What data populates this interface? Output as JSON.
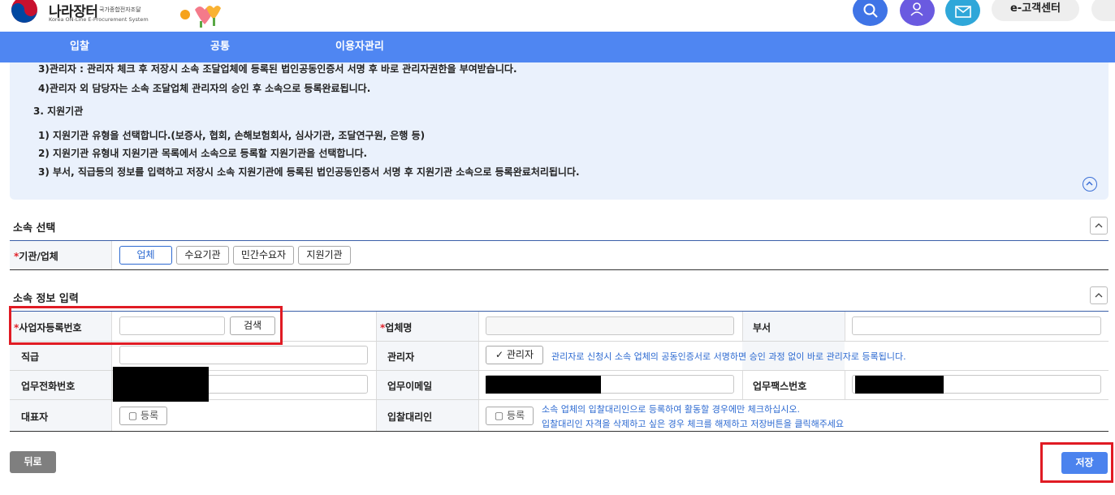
{
  "header": {
    "logo_text": "나라장터",
    "logo_sub": "국가종합전자조달",
    "logo_eng": "Korea ON-Line E-Procurement System",
    "customer_center": "e-고객센터",
    "my_label": "MY"
  },
  "nav": {
    "items": [
      "입찰",
      "공통",
      "이용자관리"
    ]
  },
  "info": {
    "lines": [
      "3)관리자 : 관리자 체크 후 저장시 소속 조달업체에 등록된 법인공동인증서 서명 후 바로 관리자권한을 부여받습니다.",
      "4)관리자 외 담당자는 소속 조달업체 관리자의 승인 후 소속으로 등록완료됩니다.",
      "3. 지원기관",
      "1) 지원기관 유형을 선택합니다.(보증사, 협회, 손해보험회사, 심사기관, 조달연구원, 은행 등)",
      "2) 지원기관 유형내 지원기관 목록에서 소속으로 등록할 지원기관을 선택합니다.",
      "3) 부서, 직급등의 정보를 입력하고 저장시 소속 지원기관에 등록된 법인공동인증서 서명 후 지원기관 소속으로 등록완료처리됩니다."
    ]
  },
  "affiliation": {
    "title": "소속 선택",
    "label": "기관/업체",
    "required_mark": "*",
    "options": [
      "업체",
      "수요기관",
      "민간수요자",
      "지원기관"
    ],
    "selected": "업체"
  },
  "form": {
    "title": "소속 정보 입력",
    "brn_label": "사업자등록번호",
    "search_btn": "검색",
    "company_label": "업체명",
    "dept_label": "부서",
    "rank_label": "직급",
    "admin_label": "관리자",
    "admin_check": "✓ 관리자",
    "admin_note": "관리자로 신청시 소속 업체의 공동인증서로 서명하면 승인 과정 없이 바로 관리자로 등록됩니다.",
    "phone_label": "업무전화번호",
    "email_label": "업무이메일",
    "fax_label": "업무팩스번호",
    "rep_label": "대표자",
    "rep_check": "▢ 등록",
    "agent_label": "입찰대리인",
    "agent_check": "▢ 등록",
    "agent_note1": "소속 업체의 입찰대리인으로 등록하여 활동할 경우에만 체크하십시오.",
    "agent_note2": "입찰대리인 자격을 삭제하고 싶은 경우 체크를 해제하고 저장버튼을 클릭해주세요"
  },
  "footer": {
    "back": "뒤로",
    "save": "저장"
  },
  "colors": {
    "nav": "#4f86f2",
    "info_bg": "#eaf1fc",
    "accent": "#2d6ad1",
    "highlight": "#e01b24"
  }
}
